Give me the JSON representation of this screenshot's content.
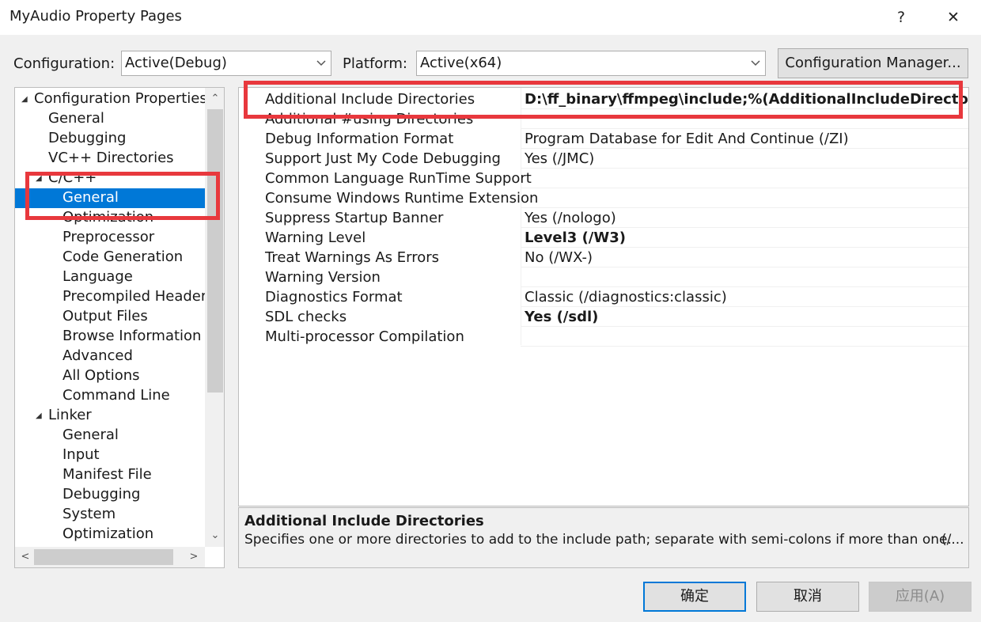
{
  "window": {
    "title": "MyAudio Property Pages",
    "help_label": "?",
    "close_label": "✕"
  },
  "toolbar": {
    "configuration_label": "Configuration:",
    "configuration_value": "Active(Debug)",
    "platform_label": "Platform:",
    "platform_value": "Active(x64)",
    "config_manager_label": "Configuration Manager..."
  },
  "tree": {
    "items": [
      {
        "label": "Configuration Properties",
        "expander": "◢"
      },
      {
        "label": "General"
      },
      {
        "label": "Debugging"
      },
      {
        "label": "VC++ Directories"
      },
      {
        "label": "C/C++",
        "expander": "◢"
      },
      {
        "label": "General",
        "selected": true
      },
      {
        "label": "Optimization"
      },
      {
        "label": "Preprocessor"
      },
      {
        "label": "Code Generation"
      },
      {
        "label": "Language"
      },
      {
        "label": "Precompiled Headers"
      },
      {
        "label": "Output Files"
      },
      {
        "label": "Browse Information"
      },
      {
        "label": "Advanced"
      },
      {
        "label": "All Options"
      },
      {
        "label": "Command Line"
      },
      {
        "label": "Linker",
        "expander": "◢"
      },
      {
        "label": "General"
      },
      {
        "label": "Input"
      },
      {
        "label": "Manifest File"
      },
      {
        "label": "Debugging"
      },
      {
        "label": "System"
      },
      {
        "label": "Optimization"
      }
    ]
  },
  "properties": [
    {
      "name": "Additional Include Directories",
      "value": "D:\\ff_binary\\ffmpeg\\include;%(AdditionalIncludeDirectories)",
      "bold": true
    },
    {
      "name": "Additional #using Directories",
      "value": ""
    },
    {
      "name": "Debug Information Format",
      "value": "Program Database for Edit And Continue (/ZI)"
    },
    {
      "name": "Support Just My Code Debugging",
      "value": "Yes (/JMC)"
    },
    {
      "name": "Common Language RunTime Support",
      "value": ""
    },
    {
      "name": "Consume Windows Runtime Extension",
      "value": ""
    },
    {
      "name": "Suppress Startup Banner",
      "value": "Yes (/nologo)"
    },
    {
      "name": "Warning Level",
      "value": "Level3 (/W3)",
      "bold": true
    },
    {
      "name": "Treat Warnings As Errors",
      "value": "No (/WX-)"
    },
    {
      "name": "Warning Version",
      "value": ""
    },
    {
      "name": "Diagnostics Format",
      "value": "Classic (/diagnostics:classic)"
    },
    {
      "name": "SDL checks",
      "value": "Yes (/sdl)",
      "bold": true
    },
    {
      "name": "Multi-processor Compilation",
      "value": ""
    }
  ],
  "description": {
    "title": "Additional Include Directories",
    "text": "Specifies one or more directories to add to the include path; separate with semi-colons if more than one.",
    "overflow": "(/..."
  },
  "buttons": {
    "ok": "确定",
    "cancel": "取消",
    "apply": "应用(A)"
  },
  "colors": {
    "selection": "#0078d7",
    "highlight_box": "#e8383d"
  }
}
